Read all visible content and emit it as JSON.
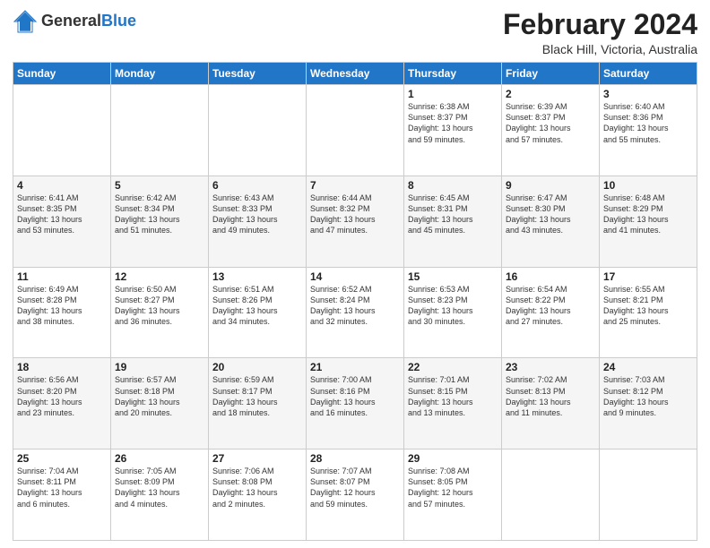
{
  "header": {
    "logo_general": "General",
    "logo_blue": "Blue",
    "month_title": "February 2024",
    "location": "Black Hill, Victoria, Australia"
  },
  "days_of_week": [
    "Sunday",
    "Monday",
    "Tuesday",
    "Wednesday",
    "Thursday",
    "Friday",
    "Saturday"
  ],
  "weeks": [
    [
      {
        "day": "",
        "info": ""
      },
      {
        "day": "",
        "info": ""
      },
      {
        "day": "",
        "info": ""
      },
      {
        "day": "",
        "info": ""
      },
      {
        "day": "1",
        "info": "Sunrise: 6:38 AM\nSunset: 8:37 PM\nDaylight: 13 hours\nand 59 minutes."
      },
      {
        "day": "2",
        "info": "Sunrise: 6:39 AM\nSunset: 8:37 PM\nDaylight: 13 hours\nand 57 minutes."
      },
      {
        "day": "3",
        "info": "Sunrise: 6:40 AM\nSunset: 8:36 PM\nDaylight: 13 hours\nand 55 minutes."
      }
    ],
    [
      {
        "day": "4",
        "info": "Sunrise: 6:41 AM\nSunset: 8:35 PM\nDaylight: 13 hours\nand 53 minutes."
      },
      {
        "day": "5",
        "info": "Sunrise: 6:42 AM\nSunset: 8:34 PM\nDaylight: 13 hours\nand 51 minutes."
      },
      {
        "day": "6",
        "info": "Sunrise: 6:43 AM\nSunset: 8:33 PM\nDaylight: 13 hours\nand 49 minutes."
      },
      {
        "day": "7",
        "info": "Sunrise: 6:44 AM\nSunset: 8:32 PM\nDaylight: 13 hours\nand 47 minutes."
      },
      {
        "day": "8",
        "info": "Sunrise: 6:45 AM\nSunset: 8:31 PM\nDaylight: 13 hours\nand 45 minutes."
      },
      {
        "day": "9",
        "info": "Sunrise: 6:47 AM\nSunset: 8:30 PM\nDaylight: 13 hours\nand 43 minutes."
      },
      {
        "day": "10",
        "info": "Sunrise: 6:48 AM\nSunset: 8:29 PM\nDaylight: 13 hours\nand 41 minutes."
      }
    ],
    [
      {
        "day": "11",
        "info": "Sunrise: 6:49 AM\nSunset: 8:28 PM\nDaylight: 13 hours\nand 38 minutes."
      },
      {
        "day": "12",
        "info": "Sunrise: 6:50 AM\nSunset: 8:27 PM\nDaylight: 13 hours\nand 36 minutes."
      },
      {
        "day": "13",
        "info": "Sunrise: 6:51 AM\nSunset: 8:26 PM\nDaylight: 13 hours\nand 34 minutes."
      },
      {
        "day": "14",
        "info": "Sunrise: 6:52 AM\nSunset: 8:24 PM\nDaylight: 13 hours\nand 32 minutes."
      },
      {
        "day": "15",
        "info": "Sunrise: 6:53 AM\nSunset: 8:23 PM\nDaylight: 13 hours\nand 30 minutes."
      },
      {
        "day": "16",
        "info": "Sunrise: 6:54 AM\nSunset: 8:22 PM\nDaylight: 13 hours\nand 27 minutes."
      },
      {
        "day": "17",
        "info": "Sunrise: 6:55 AM\nSunset: 8:21 PM\nDaylight: 13 hours\nand 25 minutes."
      }
    ],
    [
      {
        "day": "18",
        "info": "Sunrise: 6:56 AM\nSunset: 8:20 PM\nDaylight: 13 hours\nand 23 minutes."
      },
      {
        "day": "19",
        "info": "Sunrise: 6:57 AM\nSunset: 8:18 PM\nDaylight: 13 hours\nand 20 minutes."
      },
      {
        "day": "20",
        "info": "Sunrise: 6:59 AM\nSunset: 8:17 PM\nDaylight: 13 hours\nand 18 minutes."
      },
      {
        "day": "21",
        "info": "Sunrise: 7:00 AM\nSunset: 8:16 PM\nDaylight: 13 hours\nand 16 minutes."
      },
      {
        "day": "22",
        "info": "Sunrise: 7:01 AM\nSunset: 8:15 PM\nDaylight: 13 hours\nand 13 minutes."
      },
      {
        "day": "23",
        "info": "Sunrise: 7:02 AM\nSunset: 8:13 PM\nDaylight: 13 hours\nand 11 minutes."
      },
      {
        "day": "24",
        "info": "Sunrise: 7:03 AM\nSunset: 8:12 PM\nDaylight: 13 hours\nand 9 minutes."
      }
    ],
    [
      {
        "day": "25",
        "info": "Sunrise: 7:04 AM\nSunset: 8:11 PM\nDaylight: 13 hours\nand 6 minutes."
      },
      {
        "day": "26",
        "info": "Sunrise: 7:05 AM\nSunset: 8:09 PM\nDaylight: 13 hours\nand 4 minutes."
      },
      {
        "day": "27",
        "info": "Sunrise: 7:06 AM\nSunset: 8:08 PM\nDaylight: 13 hours\nand 2 minutes."
      },
      {
        "day": "28",
        "info": "Sunrise: 7:07 AM\nSunset: 8:07 PM\nDaylight: 12 hours\nand 59 minutes."
      },
      {
        "day": "29",
        "info": "Sunrise: 7:08 AM\nSunset: 8:05 PM\nDaylight: 12 hours\nand 57 minutes."
      },
      {
        "day": "",
        "info": ""
      },
      {
        "day": "",
        "info": ""
      }
    ]
  ]
}
